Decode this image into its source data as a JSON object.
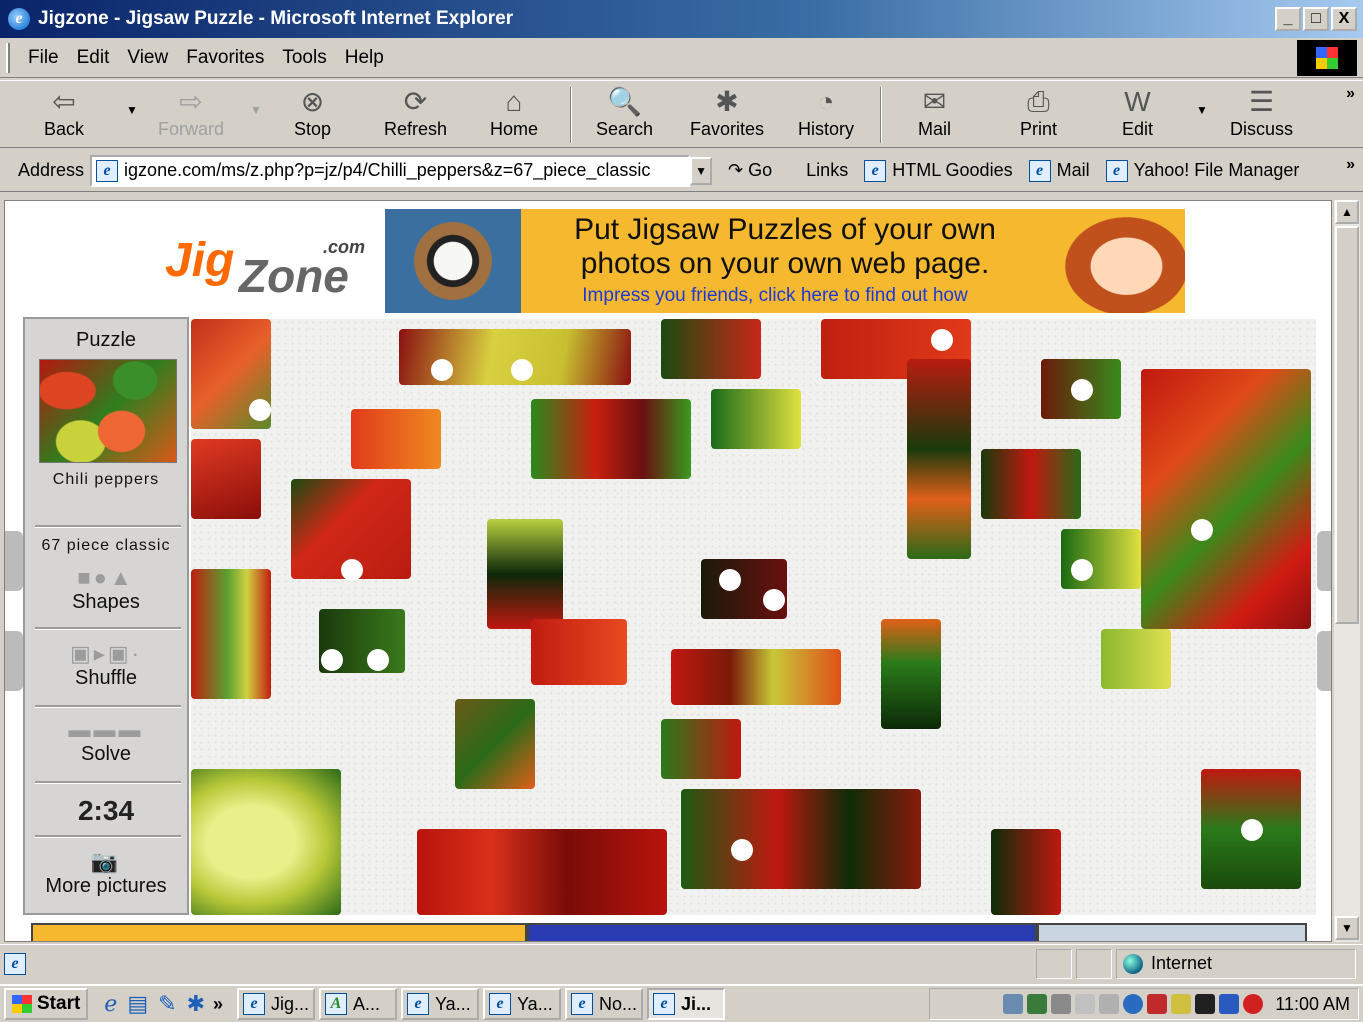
{
  "window": {
    "title": "Jigzone - Jigsaw Puzzle - Microsoft Internet Explorer",
    "min": "_",
    "max": "□",
    "close": "X"
  },
  "menu": [
    "File",
    "Edit",
    "View",
    "Favorites",
    "Tools",
    "Help"
  ],
  "toolbar": {
    "back": "Back",
    "forward": "Forward",
    "stop": "Stop",
    "refresh": "Refresh",
    "home": "Home",
    "search": "Search",
    "favorites": "Favorites",
    "history": "History",
    "mail": "Mail",
    "print": "Print",
    "edit": "Edit",
    "discuss": "Discuss",
    "overflow": "»"
  },
  "address": {
    "label": "Address",
    "url": "igzone.com/ms/z.php?p=jz/p4/Chilli_peppers&z=67_piece_classic",
    "go": "Go",
    "links_label": "Links",
    "links": [
      "HTML Goodies",
      "Mail",
      "Yahoo! File Manager"
    ],
    "overflow": "»"
  },
  "site": {
    "logo_jig": "Jig",
    "logo_zone": "Zone",
    "logo_com": ".com",
    "banner_line1": "Put Jigsaw Puzzles of your own",
    "banner_line2": "photos on your own web page.",
    "banner_sub": "Impress you friends, click here to find out how"
  },
  "panel": {
    "puzzle_label": "Puzzle",
    "puzzle_name": "Chili peppers",
    "cut_label": "67 piece classic",
    "shapes": "Shapes",
    "shuffle": "Shuffle",
    "solve": "Solve",
    "timer": "2:34",
    "more": "More pictures"
  },
  "status": {
    "zone": "Internet"
  },
  "taskbar": {
    "start": "Start",
    "overflow": "»",
    "tasks": [
      "Jig...",
      "A...",
      "Ya...",
      "Ya...",
      "No...",
      "Ji..."
    ],
    "clock": "11:00 AM"
  },
  "colors": {
    "banner": "#f5b82e",
    "logo_orange": "#ff6a00",
    "titlebar": "#0a246a"
  }
}
